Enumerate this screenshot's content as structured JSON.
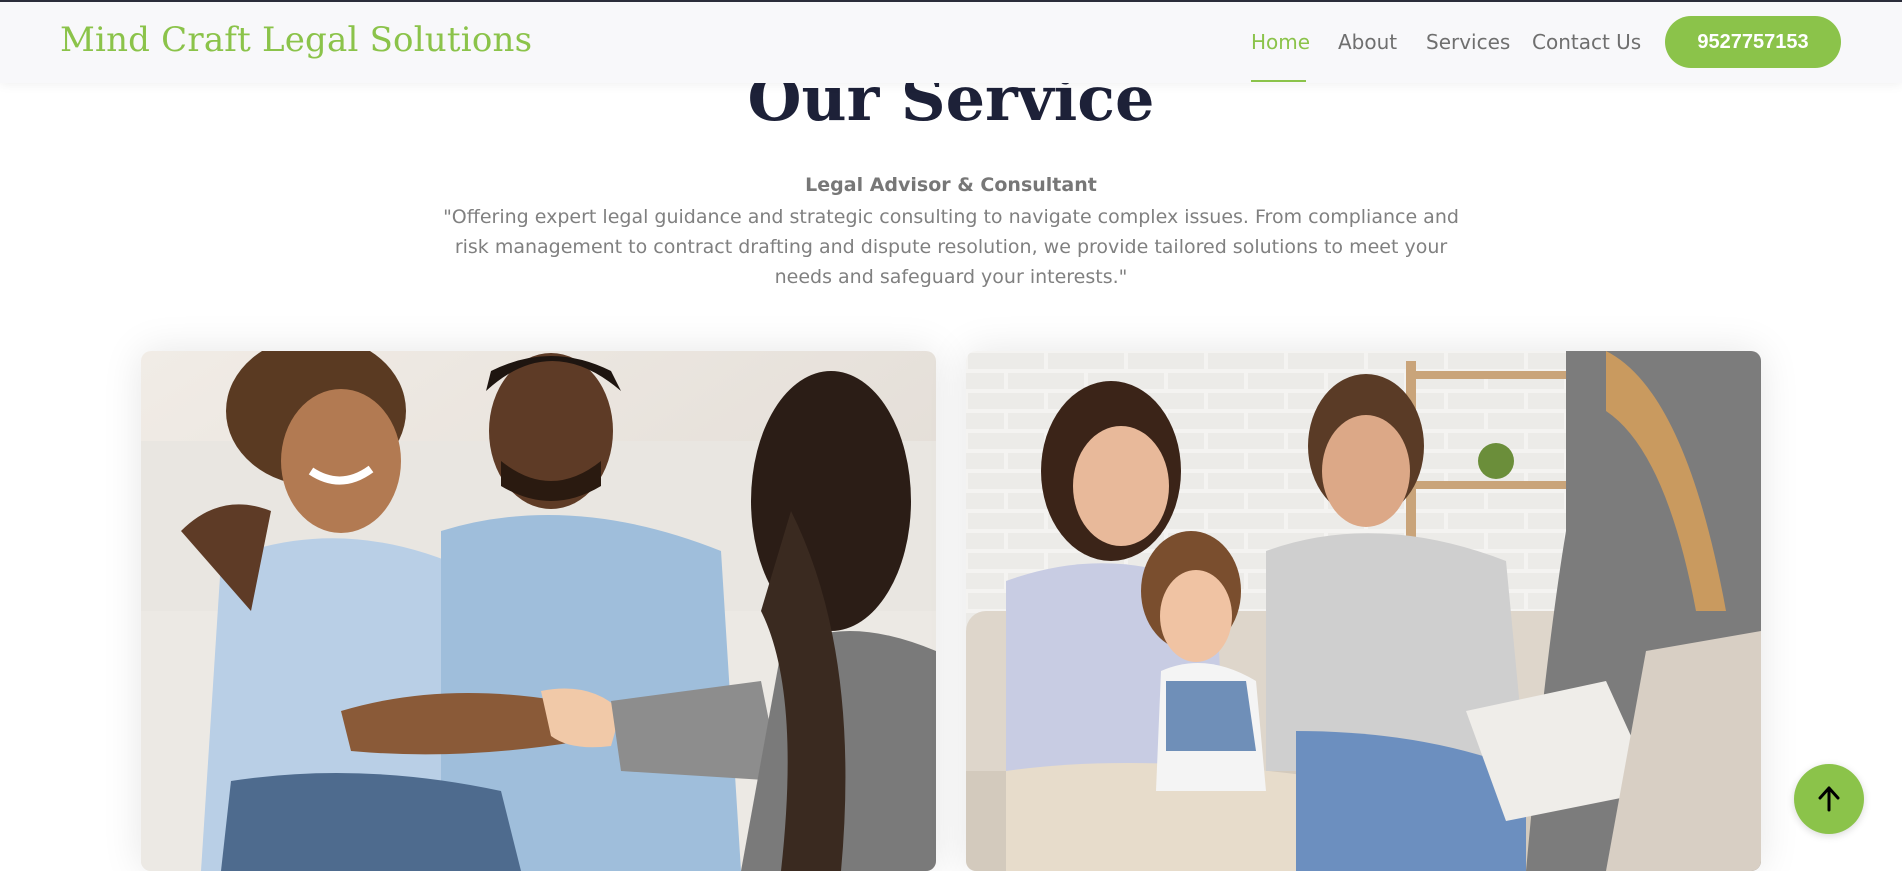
{
  "header": {
    "brand": "Mind Craft Legal Solutions",
    "nav": [
      {
        "label": "Home",
        "active": true
      },
      {
        "label": "About",
        "active": false
      },
      {
        "label": "Services",
        "active": false
      },
      {
        "label": "Contact Us",
        "active": false
      }
    ],
    "phone": "9527757153"
  },
  "section": {
    "title": "Our Service",
    "subtitle": "Legal Advisor & Consultant",
    "description": "\"Offering expert legal guidance and strategic consulting to navigate complex issues. From compliance and risk management to contract drafting and dispute resolution, we provide tailored solutions to meet your needs and safeguard your interests.\""
  },
  "cards": [
    {
      "image": "couple-handshake-with-consultant-photo"
    },
    {
      "image": "family-on-sofa-with-consultant-photo"
    }
  ],
  "colors": {
    "accent": "#8bc34a",
    "title": "#1d2138",
    "text": "#808080"
  },
  "icons": {
    "scroll_top": "arrow-up-icon"
  }
}
